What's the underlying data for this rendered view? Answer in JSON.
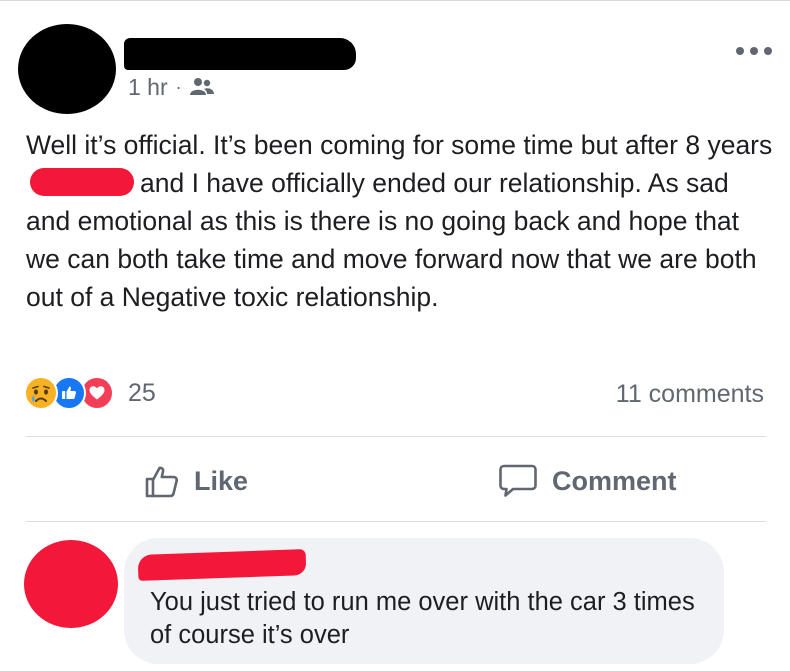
{
  "post": {
    "timestamp": "1 hr",
    "separator": "·",
    "audience_icon": "friends-icon",
    "text_part1": "Well it’s official.  It’s been coming for some time but after 8 years",
    "text_part2": "and I have officially ended our relationship. As sad and emotional as this is there is no going back and hope that we can both take time and move forward now that we are both out of a Negative toxic relationship."
  },
  "reactions": {
    "types": [
      "sad",
      "like",
      "love"
    ],
    "count": "25"
  },
  "comments_summary": "11 comments",
  "actions": {
    "like_label": "Like",
    "comment_label": "Comment"
  },
  "comment": {
    "text": "You just tried to run me over with the car 3 times of course it’s over"
  },
  "colors": {
    "redaction_black": "#000000",
    "redaction_red": "#f3173a",
    "secondary_text": "#606770",
    "like_blue": "#1877f2",
    "love_red": "#f33e58",
    "sad_yellow": "#f7b125",
    "bubble_bg": "#f0f2f5"
  }
}
